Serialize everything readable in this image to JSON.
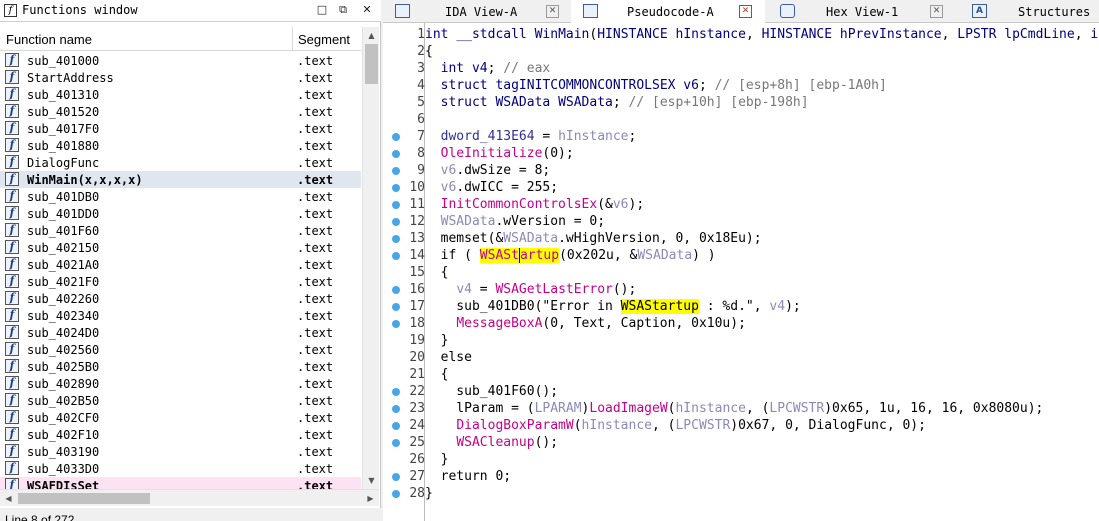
{
  "functions_window": {
    "title": "Functions window",
    "columns": {
      "name": "Function name",
      "segment": "Segment"
    },
    "status": "Line 8 of 272",
    "rows": [
      {
        "name": "sub_401000",
        "segment": ".text"
      },
      {
        "name": "StartAddress",
        "segment": ".text"
      },
      {
        "name": "sub_401310",
        "segment": ".text"
      },
      {
        "name": "sub_401520",
        "segment": ".text"
      },
      {
        "name": "sub_4017F0",
        "segment": ".text"
      },
      {
        "name": "sub_401880",
        "segment": ".text"
      },
      {
        "name": "DialogFunc",
        "segment": ".text"
      },
      {
        "name": "WinMain(x,x,x,x)",
        "segment": ".text",
        "selected": true
      },
      {
        "name": "sub_401DB0",
        "segment": ".text"
      },
      {
        "name": "sub_401DD0",
        "segment": ".text"
      },
      {
        "name": "sub_401F60",
        "segment": ".text"
      },
      {
        "name": "sub_402150",
        "segment": ".text"
      },
      {
        "name": "sub_4021A0",
        "segment": ".text"
      },
      {
        "name": "sub_4021F0",
        "segment": ".text"
      },
      {
        "name": "sub_402260",
        "segment": ".text"
      },
      {
        "name": "sub_402340",
        "segment": ".text"
      },
      {
        "name": "sub_4024D0",
        "segment": ".text"
      },
      {
        "name": "sub_402560",
        "segment": ".text"
      },
      {
        "name": "sub_4025B0",
        "segment": ".text"
      },
      {
        "name": "sub_402890",
        "segment": ".text"
      },
      {
        "name": "sub_402B50",
        "segment": ".text"
      },
      {
        "name": "sub_402CF0",
        "segment": ".text"
      },
      {
        "name": "sub_402F10",
        "segment": ".text"
      },
      {
        "name": "sub_403190",
        "segment": ".text"
      },
      {
        "name": "sub_4033D0",
        "segment": ".text"
      },
      {
        "name": "WSAFDIsSet",
        "segment": ".text",
        "library": true
      }
    ]
  },
  "tabs": [
    {
      "label": "IDA View-A",
      "icon": "ida-view-icon",
      "active": false
    },
    {
      "label": "Pseudocode-A",
      "icon": "pseudocode-icon",
      "active": true
    },
    {
      "label": "Hex View-1",
      "icon": "hex-view-icon",
      "active": false
    },
    {
      "label": "Structures",
      "icon": "structures-icon",
      "active": false
    }
  ],
  "pseudocode": {
    "highlight_word": "WSAStartup",
    "lines": [
      {
        "n": "1",
        "dot": false,
        "html": "<span class=\"k\">int</span> <span class=\"k\">__stdcall</span> <span class=\"k\">WinMain</span>(<span class=\"k\">HINSTANCE</span> <span class=\"k\">hInstance</span>, <span class=\"k\">HINSTANCE</span> <span class=\"k\">hPrevInstance</span>, <span class=\"k\">LPSTR</span> <span class=\"k\">lpCmdLine</span>, <span class=\"k\">int</span> <span class=\"k\">nShowCmd</span>)"
      },
      {
        "n": "2",
        "dot": false,
        "html": "{"
      },
      {
        "n": "3",
        "dot": false,
        "html": "  <span class=\"k\">int</span> <span class=\"k\">v4</span>; <span class=\"c\">// eax</span>"
      },
      {
        "n": "4",
        "dot": false,
        "html": "  <span class=\"k\">struct</span> <span class=\"k\">tagINITCOMMONCONTROLSEX</span> <span class=\"k\">v6</span>; <span class=\"c\">// [esp+8h] [ebp-1A0h]</span>"
      },
      {
        "n": "5",
        "dot": false,
        "html": "  <span class=\"k\">struct</span> <span class=\"k\">WSAData</span> <span class=\"k\">WSAData</span>; <span class=\"c\">// [esp+10h] [ebp-198h]</span>"
      },
      {
        "n": "6",
        "dot": false,
        "html": ""
      },
      {
        "n": "7",
        "dot": true,
        "html": "  <span class=\"g\">dword_413E64</span> = <span class=\"lg\">hInstance</span>;"
      },
      {
        "n": "8",
        "dot": true,
        "html": "  <span class=\"f\">OleInitialize</span>(0);"
      },
      {
        "n": "9",
        "dot": true,
        "html": "  <span class=\"lg\">v6</span>.dwSize = 8;"
      },
      {
        "n": "10",
        "dot": true,
        "html": "  <span class=\"lg\">v6</span>.dwICC = 255;"
      },
      {
        "n": "11",
        "dot": true,
        "html": "  <span class=\"f\">InitCommonControlsEx</span>(&amp;<span class=\"lg\">v6</span>);"
      },
      {
        "n": "12",
        "dot": true,
        "html": "  <span class=\"lg\">WSAData</span>.wVersion = 0;"
      },
      {
        "n": "13",
        "dot": true,
        "html": "  memset(&amp;<span class=\"lg\">WSAData</span>.wHighVersion, 0, 0x18Eu);"
      },
      {
        "n": "14",
        "dot": true,
        "html": "  if ( <span class=\"f hl\">WSASt<span class=\"caret\"></span>artup</span>(0x202u, &amp;<span class=\"lg\">WSAData</span>) )"
      },
      {
        "n": "15",
        "dot": false,
        "html": "  {"
      },
      {
        "n": "16",
        "dot": true,
        "html": "    <span class=\"lg\">v4</span> = <span class=\"f\">WSAGetLastError</span>();"
      },
      {
        "n": "17",
        "dot": true,
        "html": "    sub_401DB0(\"Error in <span class=\"hl\">WSAStartup</span> : %d.\", <span class=\"lg\">v4</span>);"
      },
      {
        "n": "18",
        "dot": true,
        "html": "    <span class=\"f\">MessageBoxA</span>(0, Text, Caption, 0x10u);"
      },
      {
        "n": "19",
        "dot": false,
        "html": "  }"
      },
      {
        "n": "20",
        "dot": false,
        "html": "  else"
      },
      {
        "n": "21",
        "dot": false,
        "html": "  {"
      },
      {
        "n": "22",
        "dot": true,
        "html": "    sub_401F60();"
      },
      {
        "n": "23",
        "dot": true,
        "html": "    lParam = (<span class=\"lg\">LPARAM</span>)<span class=\"f\">LoadImageW</span>(<span class=\"lg\">hInstance</span>, (<span class=\"lg\">LPCWSTR</span>)0x65, 1u, 16, 16, 0x8080u);"
      },
      {
        "n": "24",
        "dot": true,
        "html": "    <span class=\"f\">DialogBoxParamW</span>(<span class=\"lg\">hInstance</span>, (<span class=\"lg\">LPCWSTR</span>)0x67, 0, DialogFunc, 0);"
      },
      {
        "n": "25",
        "dot": true,
        "html": "    <span class=\"f\">WSACleanup</span>();"
      },
      {
        "n": "26",
        "dot": false,
        "html": "  }"
      },
      {
        "n": "27",
        "dot": true,
        "html": "  return 0;"
      },
      {
        "n": "28",
        "dot": true,
        "html": "}"
      }
    ]
  }
}
